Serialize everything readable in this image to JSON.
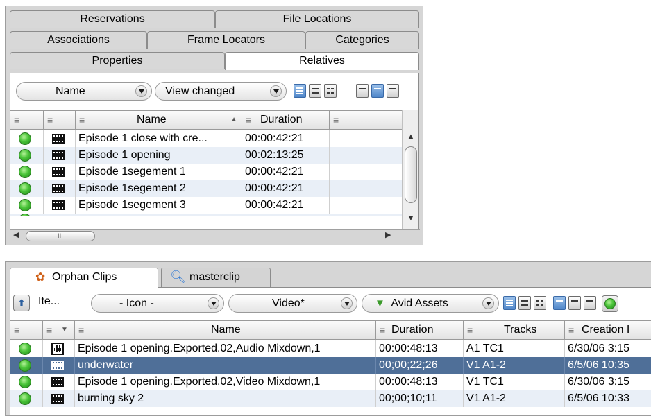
{
  "top_panel": {
    "tabs_row1": [
      "Reservations",
      "File Locations"
    ],
    "tabs_row2": [
      "Associations",
      "Frame Locators",
      "Categories"
    ],
    "tabs_row3": [
      "Properties",
      "Relatives"
    ],
    "active_tab": "Relatives",
    "toolbar": {
      "sort_dropdown": "Name",
      "view_dropdown": "View changed"
    },
    "columns": [
      "Name",
      "Duration"
    ],
    "rows": [
      {
        "name": "Episode 1 close with cre...",
        "duration": "00:00:42:21"
      },
      {
        "name": "Episode 1 opening",
        "duration": "00:02:13:25"
      },
      {
        "name": "Episode 1segement 1",
        "duration": "00:00:42:21"
      },
      {
        "name": "Episode 1segement 2",
        "duration": "00:00:42:21"
      },
      {
        "name": "Episode 1segement 3",
        "duration": "00:00:42:21"
      }
    ],
    "hscroll_grip": "III"
  },
  "bottom_panel": {
    "tabs": [
      "Orphan Clips",
      "masterclip"
    ],
    "active_tab": "Orphan Clips",
    "toolbar": {
      "items_label": "Ite...",
      "icon_dropdown": "- Icon -",
      "video_dropdown": "Video*",
      "assets_dropdown": "Avid Assets"
    },
    "columns": [
      "Name",
      "Duration",
      "Tracks",
      "Creation I"
    ],
    "rows": [
      {
        "name": "Episode 1 opening.Exported.02,Audio Mixdown,1",
        "duration": "00:00:48:13",
        "tracks": "A1 TC1",
        "creation": "6/30/06 3:15",
        "icon": "audio-clip-icon",
        "selected": false
      },
      {
        "name": "underwater",
        "duration": "00;00;22;26",
        "tracks": "V1 A1-2",
        "creation": "6/5/06 10:35",
        "icon": "video-clip-icon",
        "selected": true
      },
      {
        "name": "Episode 1 opening.Exported.02,Video Mixdown,1",
        "duration": "00:00:48:13",
        "tracks": "V1 TC1",
        "creation": "6/30/06 3:15",
        "icon": "video-clip-icon",
        "selected": false
      },
      {
        "name": "burning sky 2",
        "duration": "00;00;10;11",
        "tracks": "V1 A1-2",
        "creation": "6/5/06 10:33",
        "icon": "video-clip-icon",
        "selected": false
      }
    ]
  },
  "colors": {
    "panel_bg": "#d6d6d6",
    "row_alt": "#e9eff7",
    "selection": "#4f6f98",
    "status_green": "#4bc43a"
  }
}
